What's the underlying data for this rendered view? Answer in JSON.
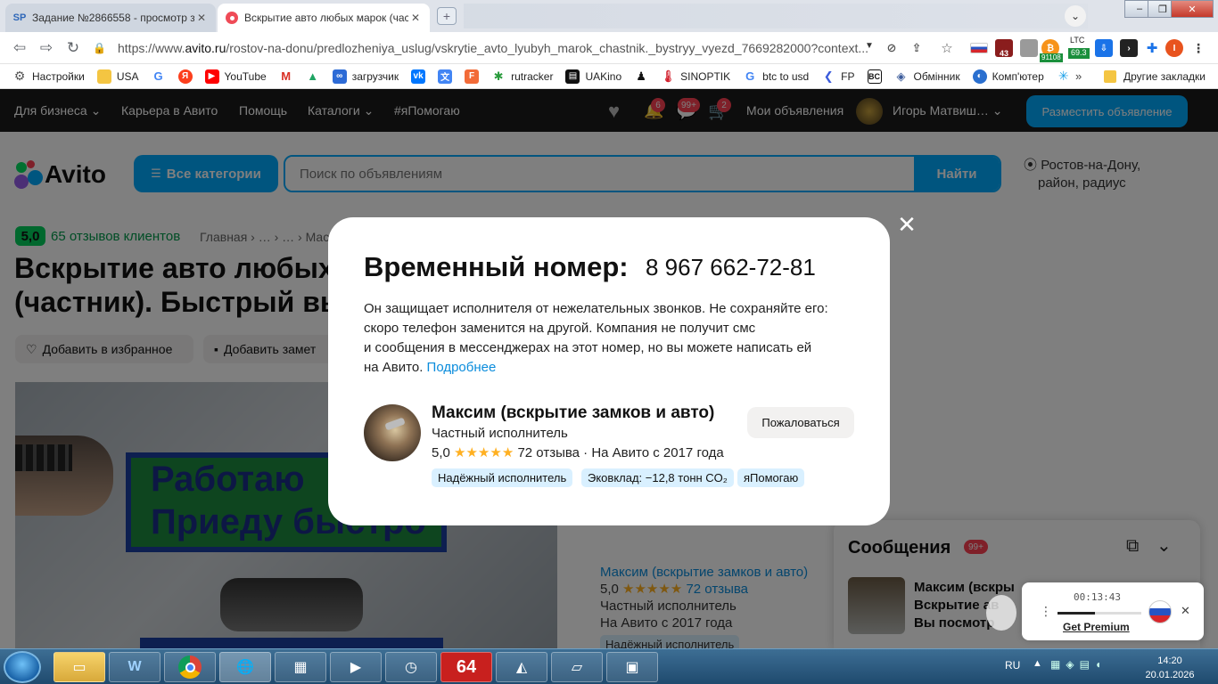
{
  "browser": {
    "tabs": [
      {
        "favicon": "SP",
        "title": "Задание №2866558 - просмотр з"
      },
      {
        "favicon": "avito-record-icon",
        "title": "Вскрытие авто любых марок (час"
      }
    ],
    "url_prefix": "https://www.",
    "url_domain": "avito.ru",
    "url_path": "/rostov-na-donu/predlozheniya_uslug/vskrytie_avto_lyubyh_marok_chastnik._bystryy_vyezd_7669282000?context...",
    "ext_badges": [
      "43",
      "91108",
      "LTC",
      "69.3"
    ],
    "profile_letter": "I",
    "bookmarks": [
      {
        "icon": "gear-icon",
        "label": "Настройки"
      },
      {
        "icon": "folder-icon",
        "label": "USA"
      },
      {
        "icon": "google-icon",
        "label": ""
      },
      {
        "icon": "yandex-icon",
        "label": ""
      },
      {
        "icon": "youtube-icon",
        "label": "YouTube"
      },
      {
        "icon": "gmail-icon",
        "label": ""
      },
      {
        "icon": "drive-icon",
        "label": ""
      },
      {
        "icon": "loop-icon",
        "label": "загрузчик"
      },
      {
        "icon": "vk-icon",
        "label": ""
      },
      {
        "icon": "translate-icon",
        "label": ""
      },
      {
        "icon": "f-icon",
        "label": ""
      },
      {
        "icon": "rutracker-icon",
        "label": "rutracker"
      },
      {
        "icon": "uakino-icon",
        "label": "UAKino"
      },
      {
        "icon": "pawn-icon",
        "label": ""
      },
      {
        "icon": "thermometer-icon",
        "label": "SINOPTIK"
      },
      {
        "icon": "google-icon",
        "label": "btc to usd"
      },
      {
        "icon": "fp-icon",
        "label": "FP"
      },
      {
        "icon": "bc-icon",
        "label": ""
      },
      {
        "icon": "exchange-icon",
        "label": "Обмінник"
      },
      {
        "icon": "computer-icon",
        "label": "Комп'ютер"
      },
      {
        "icon": "star-icon",
        "label": ""
      }
    ],
    "bookmarks_more": "»",
    "other_bookmarks": "Другие закладки"
  },
  "site": {
    "topnav": {
      "for_business": "Для бизнеса",
      "career": "Карьера в Авито",
      "help": "Помощь",
      "catalogs": "Каталоги",
      "yapomogayu": "#яПомогаю",
      "notif_badge": "6",
      "chat_badge": "99+",
      "cart_badge": "2",
      "my_ads": "Мои объявления",
      "user_name": "Игорь Матвиш…",
      "place_ad": "Разместить объявление"
    },
    "logo": "Avito",
    "all_categories": "Все категории",
    "search_placeholder": "Поиск по объявлениям",
    "search_button": "Найти",
    "location_line1": "Ростов-на-Дону,",
    "location_line2": "район, радиус",
    "rating": "5,0",
    "reviews": "65 отзывов клиентов",
    "breadcrumbs": "Главная › … › … › Мас",
    "title_line1": "Вскрытие авто любых",
    "title_line2": "(частник). Быстрый вы",
    "add_favorite": "Добавить в избранное",
    "add_note": "Добавить замет",
    "photo_sign_line1": "Работаю",
    "photo_sign_line2": "Приеду быстро",
    "seller": {
      "name": "Максим (вскрытие замков и авто)",
      "rating": "5,0",
      "stars": "★★★★★",
      "reviews": "72 отзыва",
      "type": "Частный исполнитель",
      "since": "На Авито с 2017 года",
      "tag": "Надёжный исполнитель"
    },
    "messages": {
      "title": "Сообщения",
      "badge": "99+",
      "preview_line1": "Максим (вскры",
      "preview_line2": "Вскрытие ав",
      "preview_line3": "Вы посмотр"
    }
  },
  "modal": {
    "title": "Временный номер:",
    "phone": "8 967 662-72-81",
    "desc_line1": "Он защищает исполнителя от нежелательных звонков. Не сохраняйте его:",
    "desc_line2": "скоро телефон заменится на другой. Компания не получит смс",
    "desc_line3": "и сообщения в мессенджерах на этот номер, но вы можете написать ей",
    "desc_line4": "на Авито.",
    "more_link": "Подробнее",
    "seller_name": "Максим (вскрытие замков и авто)",
    "seller_type": "Частный исполнитель",
    "rating": "5,0",
    "stars": "★★★★★",
    "reviews": "72 отзыва",
    "since": "· На Авито с 2017 года",
    "complain": "Пожаловаться",
    "tags": [
      "Надёжный исполнитель",
      "Эковклад: −12,8 тонн CO₂",
      "яПомогаю"
    ]
  },
  "timer_widget": {
    "time": "00:13:43",
    "progress": 0.45,
    "link": "Get Premium"
  },
  "taskbar": {
    "badge_64": "64",
    "lang": "RU",
    "time": "14:20",
    "date": "20.01.2026"
  },
  "colors": {
    "accent": "#00aaff",
    "rating_green": "#02d15c",
    "link_blue": "#0a8cdc",
    "badge_red": "#ff4053"
  }
}
